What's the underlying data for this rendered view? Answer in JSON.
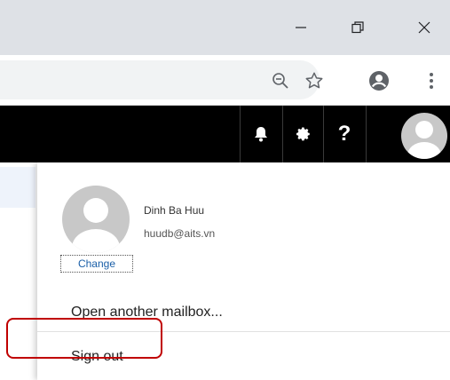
{
  "window_controls": {
    "minimize_icon": "minimize-icon",
    "restore_icon": "restore-icon",
    "close_icon": "close-icon"
  },
  "browser_toolbar": {
    "icons": [
      "zoom-out-icon",
      "star-icon",
      "account-icon",
      "menu-dots-icon"
    ]
  },
  "app_header": {
    "background": "#000000",
    "icons": [
      "bell-icon",
      "gear-icon",
      "help-icon"
    ],
    "help_label": "?"
  },
  "account_menu": {
    "user_name": "Dinh Ba Huu",
    "user_email": "huudb@aits.vn",
    "change_label": "Change",
    "items": [
      {
        "label": "Open another mailbox..."
      },
      {
        "label": "Sign out"
      }
    ]
  },
  "annotation": {
    "highlight_color": "#c00000"
  }
}
